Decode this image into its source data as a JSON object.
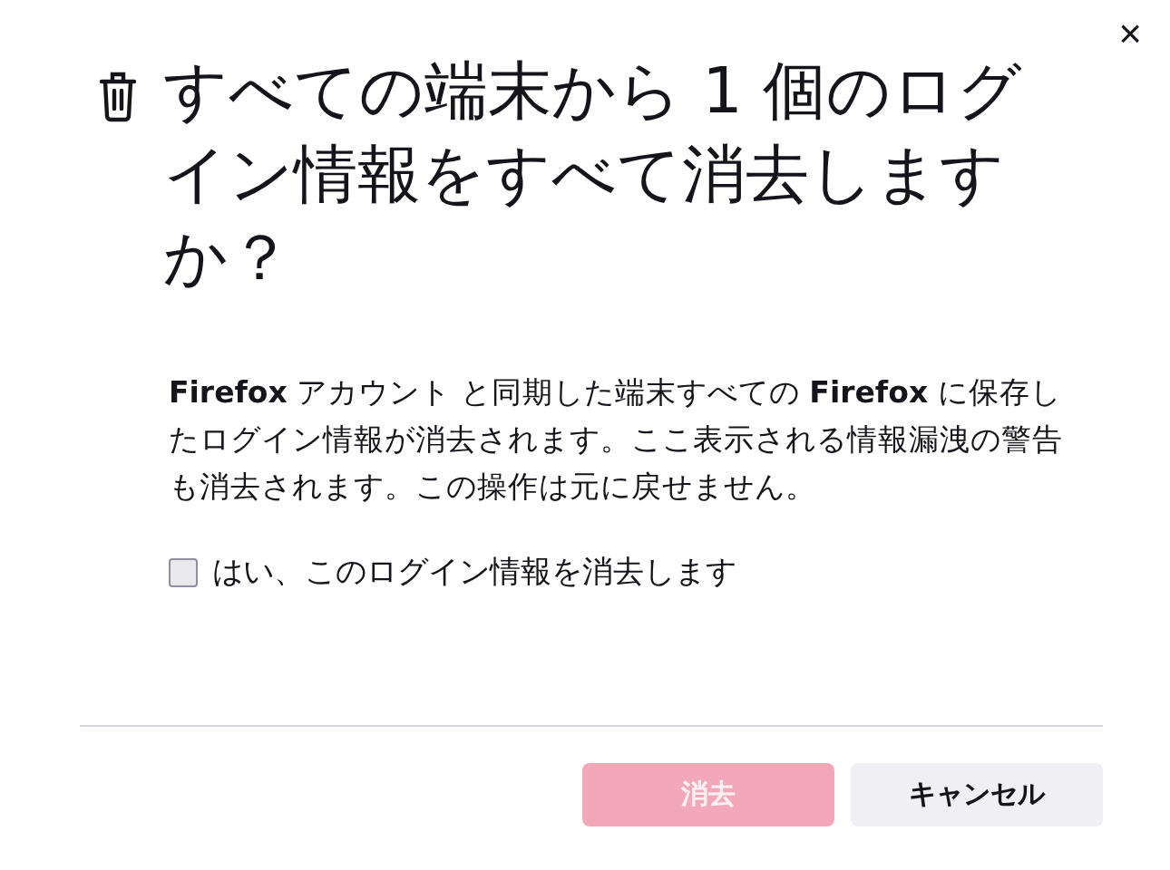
{
  "dialog": {
    "close": "×",
    "title": "すべての端末から 1 個のログイン情報をすべて消去しますか？",
    "message": "**Firefox** アカウント と同期した端末すべての **Firefox** に保存したログイン情報が消去されます。ここ表示される情報漏洩の警告も消去されます。この操作は元に戻せません。",
    "confirm": {
      "label": "はい、このログイン情報を消去します",
      "checked": false
    },
    "buttons": [
      {
        "kind": "primary",
        "label": "消去",
        "disabled": true
      },
      {
        "kind": "secondary",
        "label": "キャンセル",
        "disabled": false
      }
    ]
  }
}
